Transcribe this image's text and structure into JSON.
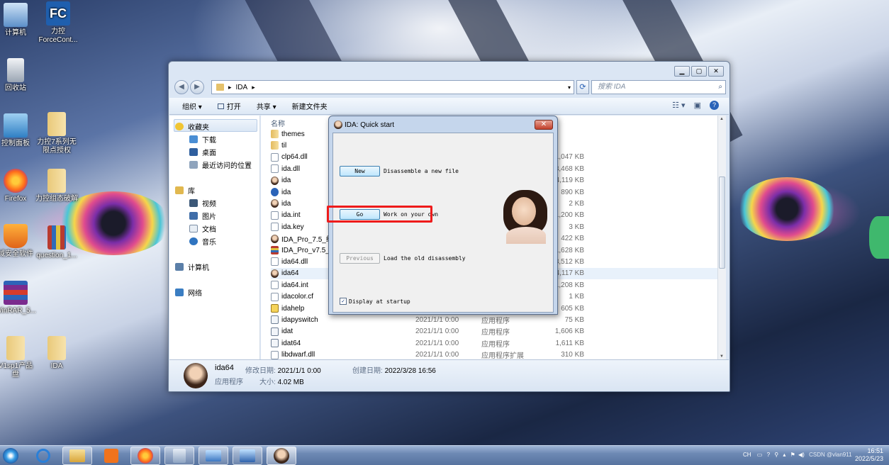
{
  "desktop": {
    "icons": [
      {
        "label": "计算机",
        "icon": "computer-icon"
      },
      {
        "label": "力控\nForceCont...",
        "icon": "forcecontrol-icon"
      },
      {
        "label": "回收站",
        "icon": "recycle-bin-icon"
      },
      {
        "label": "控制面板",
        "icon": "control-panel-icon"
      },
      {
        "label": "力控7系列无\n限点授权",
        "icon": "folder-icon"
      },
      {
        "label": "Firefox",
        "icon": "firefox-icon"
      },
      {
        "label": "力控组态破解",
        "icon": "folder-icon"
      },
      {
        "label": "域安全软件",
        "icon": "shield-icon"
      },
      {
        "label": "question_1...",
        "icon": "archive-icon"
      },
      {
        "label": "WinRAR_5...",
        "icon": "winrar-icon"
      },
      {
        "label": "V1sp1产品\n盘",
        "icon": "folder-icon"
      },
      {
        "label": "IDA",
        "icon": "folder-icon"
      }
    ]
  },
  "explorer": {
    "address": {
      "path": "IDA",
      "separator": "▸"
    },
    "search": {
      "placeholder": "搜索 IDA"
    },
    "toolbar": {
      "organize": "组织 ▾",
      "open": "打开",
      "share": "共享 ▾",
      "new_folder": "新建文件夹"
    },
    "nav": {
      "favorites": "收藏夹",
      "favorites_items": [
        "下载",
        "桌面",
        "最近访问的位置"
      ],
      "libraries": "库",
      "libraries_items": [
        "视频",
        "图片",
        "文档",
        "音乐"
      ],
      "computer": "计算机",
      "network": "网络"
    },
    "column_name": "名称",
    "files": [
      {
        "name": "themes",
        "date": "",
        "type": "",
        "size": "",
        "icon": "folder-icon"
      },
      {
        "name": "til",
        "date": "",
        "type": "",
        "size": "",
        "icon": "folder-icon"
      },
      {
        "name": "clp64.dll",
        "date": "",
        "type": "",
        "size": "1,047 KB",
        "icon": "dll-icon"
      },
      {
        "name": "ida.dll",
        "date": "",
        "type": "",
        "size": "3,468 KB",
        "icon": "dll-icon"
      },
      {
        "name": "ida",
        "date": "",
        "type": "",
        "size": "4,119 KB",
        "icon": "ida-icon"
      },
      {
        "name": "ida",
        "date": "",
        "type": "",
        "size": "890 KB",
        "icon": "help-icon"
      },
      {
        "name": "ida",
        "date": "",
        "type": "",
        "size": "2 KB",
        "icon": "ida-icon"
      },
      {
        "name": "ida.int",
        "date": "",
        "type": "",
        "size": "1,200 KB",
        "icon": "file-icon"
      },
      {
        "name": "ida.key",
        "date": "",
        "type": "",
        "size": "3 KB",
        "icon": "file-icon"
      },
      {
        "name": "IDA_Pro_7.5_绿...",
        "date": "",
        "type": "",
        "size": "422 KB",
        "icon": "ida-icon"
      },
      {
        "name": "IDA_Pro_v7.5_P...",
        "date": "",
        "type": "",
        "size": "1,628 KB",
        "icon": "archive-icon"
      },
      {
        "name": "ida64.dll",
        "date": "",
        "type": "",
        "size": "3,512 KB",
        "icon": "dll-icon"
      },
      {
        "name": "ida64",
        "date": "",
        "type": "",
        "size": "4,117 KB",
        "icon": "ida-icon"
      },
      {
        "name": "ida64.int",
        "date": "",
        "type": "",
        "size": "1,208 KB",
        "icon": "file-icon"
      },
      {
        "name": "idacolor.cf",
        "date": "",
        "type": "",
        "size": "1 KB",
        "icon": "file-icon"
      },
      {
        "name": "idahelp",
        "date": "",
        "type": "",
        "size": "605 KB",
        "icon": "help-file-icon"
      },
      {
        "name": "idapyswitch",
        "date": "2021/1/1 0:00",
        "type": "应用程序",
        "size": "75 KB",
        "icon": "exe-icon"
      },
      {
        "name": "idat",
        "date": "2021/1/1 0:00",
        "type": "应用程序",
        "size": "1,606 KB",
        "icon": "exe-icon"
      },
      {
        "name": "idat64",
        "date": "2021/1/1 0:00",
        "type": "应用程序",
        "size": "1,611 KB",
        "icon": "exe-icon"
      },
      {
        "name": "libdwarf.dll",
        "date": "2021/1/1 0:00",
        "type": "应用程序扩展",
        "size": "310 KB",
        "icon": "dll-icon"
      }
    ],
    "details": {
      "name": "ida64",
      "type": "应用程序",
      "modified_label": "修改日期:",
      "modified": "2021/1/1 0:00",
      "created_label": "创建日期:",
      "created": "2022/3/28 16:56",
      "size_label": "大小:",
      "size": "4.02 MB"
    }
  },
  "quickstart": {
    "title": "IDA: Quick start",
    "close": "✕",
    "new_button": "New",
    "new_desc": "Disassemble a new file",
    "go_button": "Go",
    "go_desc": "Work on your own",
    "previous_button": "Previous",
    "previous_desc": "Load the old disassembly",
    "display_at_startup": "Display at startup",
    "display_checked": true
  },
  "taskbar": {
    "tray_text": "CH",
    "time": "16:51",
    "date": "2022/5/23",
    "watermark": "CSDN @vlan911"
  },
  "colors": {
    "highlight": "#ee1b1b",
    "selection": "#e8f1fb"
  }
}
